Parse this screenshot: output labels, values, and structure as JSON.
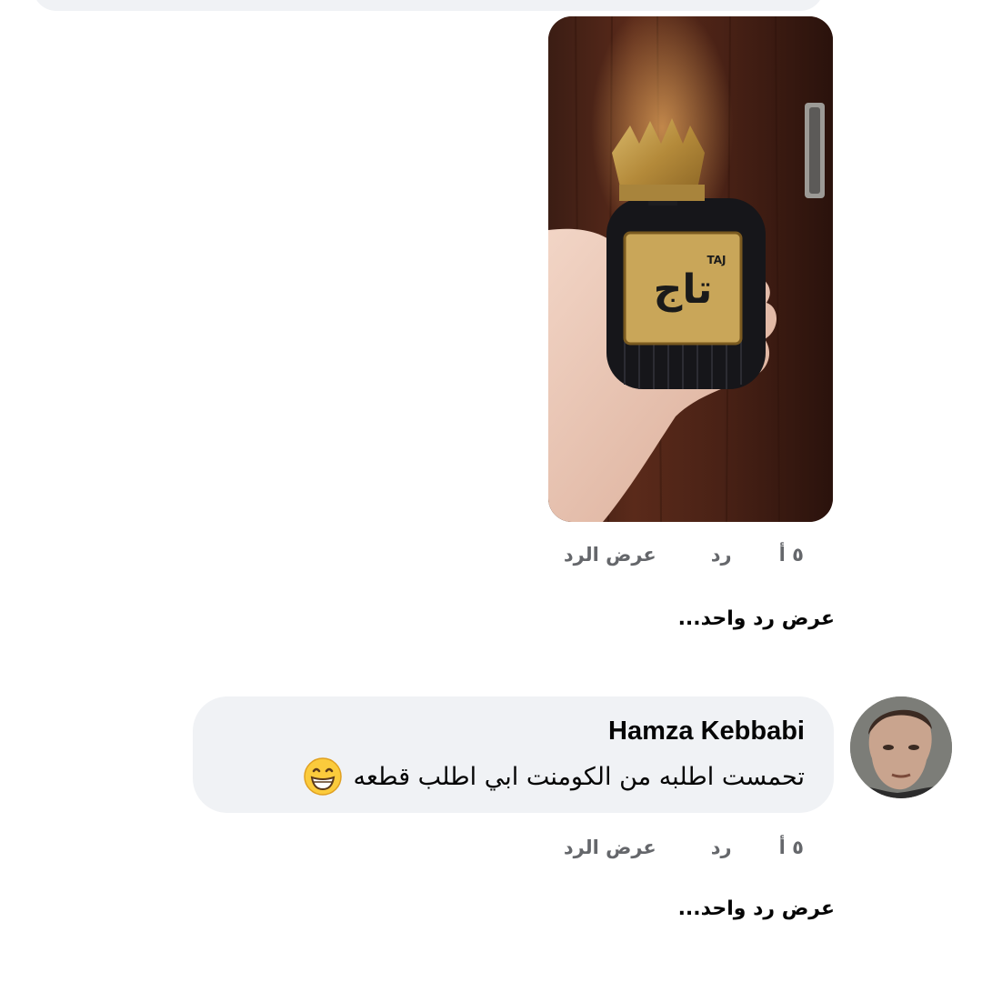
{
  "first_comment": {
    "photo_alt": "perfume bottle photo",
    "bottle_brand_label": "تاج",
    "bottle_latin_label": "TAJ",
    "actions": {
      "time": "٥ أ",
      "reply": "رد",
      "translate": "عرض الرد"
    },
    "view_replies": "عرض رد واحد..."
  },
  "second_comment": {
    "author": "Hamza Kebbabi",
    "text": "تحمست اطلبه من الكومنت ابي اطلب قطعه",
    "emoji_icon": "grinning-face-with-smiling-eyes-icon",
    "actions": {
      "time": "٥ أ",
      "reply": "رد",
      "translate": "عرض الرد"
    },
    "view_replies": "عرض رد واحد..."
  },
  "colors": {
    "bubble_bg": "#f0f2f5",
    "meta_text": "#65676b",
    "primary_text": "#050505"
  }
}
